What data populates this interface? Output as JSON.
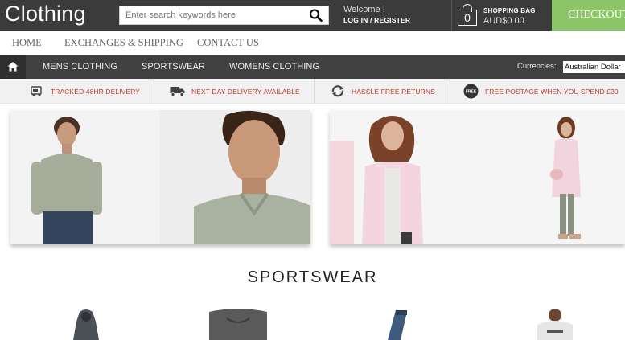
{
  "header": {
    "logo": "Clothing",
    "search_placeholder": "Enter search keywords here",
    "welcome": "Welcome !",
    "login_register": "LOG IN / REGISTER",
    "bag_label": "SHOPPING BAG",
    "bag_count": "0",
    "bag_total": "AUD$0.00",
    "checkout_label": "CHECKOUT"
  },
  "top_nav": {
    "home": "HOME",
    "exchanges": "EXCHANGES & SHIPPING",
    "contact": "CONTACT US"
  },
  "category_nav": {
    "items": [
      "MENS CLOTHING",
      "SPORTSWEAR",
      "WOMENS CLOTHING"
    ],
    "currency_label": "Currencies:",
    "currency_value": "Australian Dollar"
  },
  "info_bar": {
    "items": [
      {
        "label": "TRACKED 48HR DELIVERY",
        "icon": "truck-parcel-icon"
      },
      {
        "label": "NEXT DAY DELIVERY AVAILABLE",
        "icon": "delivery-truck-icon"
      },
      {
        "label": "HASSLE FREE RETURNS",
        "icon": "returns-arrows-icon"
      },
      {
        "label": "FREE POSTAGE WHEN YOU SPEND £30",
        "icon": "free-badge-icon"
      }
    ],
    "free_badge_text": "FREE",
    "accent_color": "#c0392b"
  },
  "section": {
    "title": "SPORTSWEAR"
  },
  "colors": {
    "header_bg": "#3b3b3b",
    "checkout_bg": "#8bc567",
    "catnav_bg": "#404040"
  }
}
